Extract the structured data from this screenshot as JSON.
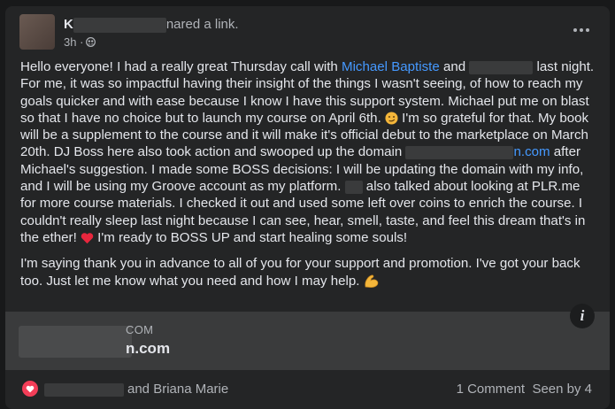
{
  "post": {
    "author_initial": "K",
    "action_text": "nared a link.",
    "time": "3h ·",
    "privacy_icon": "friends-icon",
    "more_icon": "more-horizontal-icon"
  },
  "body": {
    "p1_start": "Hello everyone! I had a really great Thursday call with ",
    "mention_1": "Michael Baptiste",
    "p1_and": " and ",
    "mention_2_partial": "",
    "p1_rest_a": " last night. For me, it was so impactful having their insight of the things I wasn't seeing, of how to reach my goals quicker and with ease because I know I have this support system. Michael put me on blast so that I have no choice but to launch my course on April 6th. ",
    "p1_rest_b": " I'm so grateful for that. My book will be a supplement to the course and it will make it's official debut to the marketplace on March 20th. DJ Boss here also took action and swooped up the domain ",
    "domain_link": "n.com",
    "p1_rest_c": " after Michael's suggestion. I made some BOSS decisions: I will be updating the domain with my info, and I will be using my Groove account as my platform. ",
    "p1_rest_d": " also talked about looking at PLR.me for more course materials. I checked it out and used some left over coins to enrich the course. I couldn't really sleep last night because I can see, hear, smell, taste, and feel this dream that's in the ether! ",
    "p1_rest_e": " I'm ready to BOSS UP and start healing some souls!",
    "p2": "I'm saying thank you in advance to all of you for your support and promotion. I've got your back too. Just let me know what you need and how I may help. ",
    "emoji_1": "smirk-emoji",
    "emoji_2": "red-heart-emoji",
    "emoji_3": "flexed-biceps-emoji"
  },
  "link_preview": {
    "domain_small": "COM",
    "domain_main": "n.com",
    "info_icon": "i"
  },
  "footer": {
    "reaction_icon": "love-reaction-icon",
    "reactors": "and Briana Marie",
    "comments": "1 Comment",
    "seen": "Seen by 4"
  },
  "colors": {
    "background": "#18191a",
    "card": "#242526",
    "text": "#e4e6eb",
    "secondary": "#b0b3b8",
    "link": "#4599ff",
    "love": "#f33e58"
  }
}
